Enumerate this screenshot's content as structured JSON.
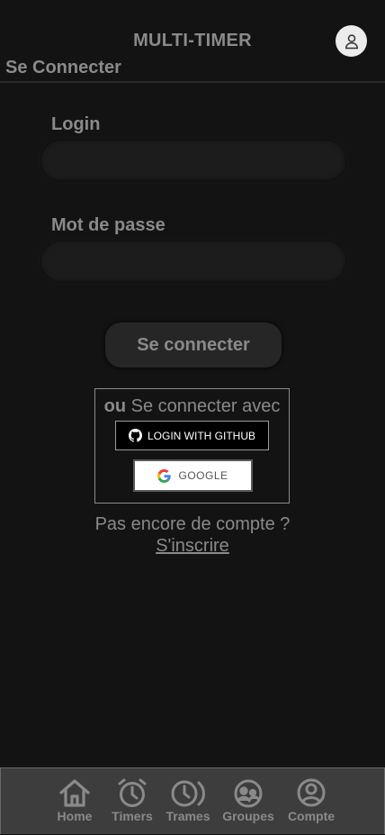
{
  "header": {
    "app_title": "MULTI-TIMER",
    "page_title": "Se Connecter",
    "avatar_icon": "user-icon"
  },
  "form": {
    "login_label": "Login",
    "login_value": "",
    "password_label": "Mot de passe",
    "password_value": "",
    "submit_label": "Se connecter"
  },
  "oauth": {
    "prefix": "ou",
    "title": " Se connecter avec",
    "github_label": "LOGIN WITH GITHUB",
    "google_label": "GOOGLE"
  },
  "signup": {
    "question": "Pas encore de compte ?",
    "link": "S'inscrire"
  },
  "nav": {
    "items": [
      {
        "label": "Home",
        "icon": "home-icon"
      },
      {
        "label": "Timers",
        "icon": "alarm-clock-icon"
      },
      {
        "label": "Trames",
        "icon": "history-clock-icon"
      },
      {
        "label": "Groupes",
        "icon": "group-icon"
      },
      {
        "label": "Compte",
        "icon": "account-icon"
      }
    ]
  },
  "colors": {
    "background": "#131313",
    "text": "#8a8a8a",
    "nav_background": "#3d3d3d"
  }
}
